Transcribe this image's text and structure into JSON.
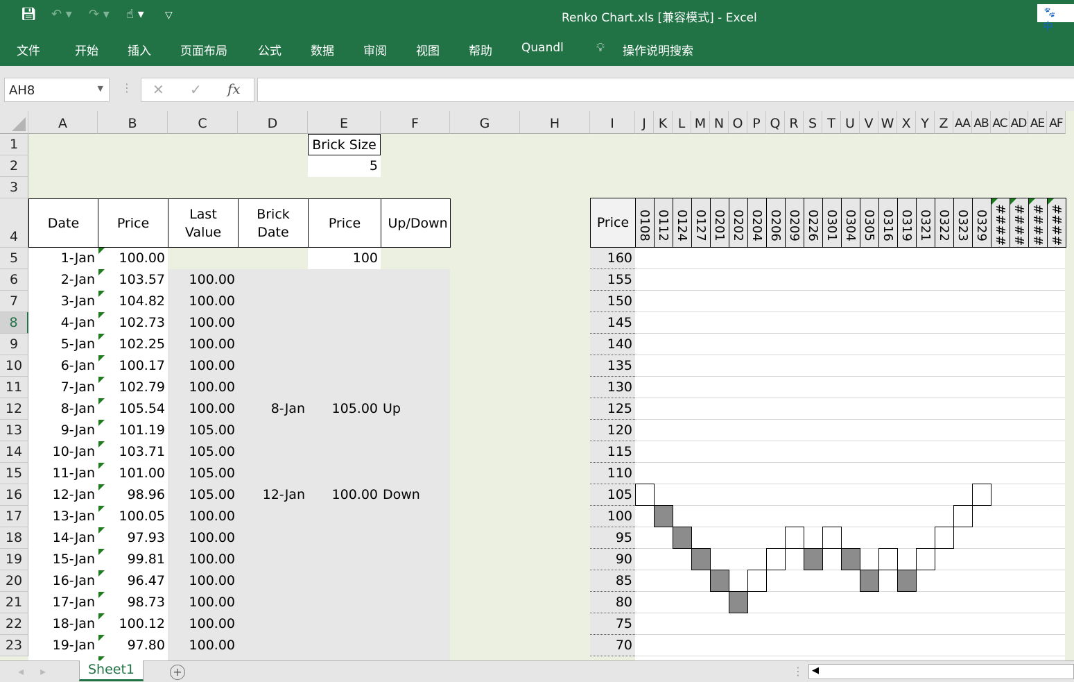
{
  "window": {
    "title": "Renko Chart.xls  [兼容模式]  -  Excel",
    "ime_badge": "中"
  },
  "quick_access": {
    "save": "save-icon",
    "undo": "undo-icon",
    "redo": "redo-icon",
    "touch": "touch-mode-icon",
    "customize": "customize-icon"
  },
  "ribbon": {
    "tabs": [
      "文件",
      "开始",
      "插入",
      "页面布局",
      "公式",
      "数据",
      "审阅",
      "视图",
      "帮助",
      "Quandl"
    ],
    "tell_me": "操作说明搜索"
  },
  "formula_bar": {
    "name_box": "AH8",
    "cancel": "✕",
    "enter": "✓",
    "fx": "fx",
    "value": ""
  },
  "columns": [
    "A",
    "B",
    "C",
    "D",
    "E",
    "F",
    "G",
    "H",
    "I",
    "J",
    "K",
    "L",
    "M",
    "N",
    "O",
    "P",
    "Q",
    "R",
    "S",
    "T",
    "U",
    "V",
    "W",
    "X",
    "Y",
    "Z",
    "AA",
    "AB",
    "AC",
    "AD",
    "AE",
    "AF"
  ],
  "rows": [
    "1",
    "2",
    "3",
    "4",
    "5",
    "6",
    "7",
    "8",
    "9",
    "10",
    "11",
    "12",
    "13",
    "14",
    "15",
    "16",
    "17",
    "18",
    "19",
    "20",
    "21",
    "22",
    "23"
  ],
  "selected_row": "8",
  "brick_size": {
    "label": "Brick Size",
    "value": "5"
  },
  "table": {
    "headers": [
      "Date",
      "Price",
      "Last Value",
      "Brick Date",
      "Price",
      "Up/Down"
    ],
    "first_brick_price": "100",
    "rows": [
      [
        "1-Jan",
        "100.00",
        "",
        "",
        "",
        ""
      ],
      [
        "2-Jan",
        "103.57",
        "100.00",
        "",
        "",
        ""
      ],
      [
        "3-Jan",
        "104.82",
        "100.00",
        "",
        "",
        ""
      ],
      [
        "4-Jan",
        "102.73",
        "100.00",
        "",
        "",
        ""
      ],
      [
        "5-Jan",
        "102.25",
        "100.00",
        "",
        "",
        ""
      ],
      [
        "6-Jan",
        "100.17",
        "100.00",
        "",
        "",
        ""
      ],
      [
        "7-Jan",
        "102.79",
        "100.00",
        "",
        "",
        ""
      ],
      [
        "8-Jan",
        "105.54",
        "100.00",
        "8-Jan",
        "105.00",
        "Up"
      ],
      [
        "9-Jan",
        "101.19",
        "105.00",
        "",
        "",
        ""
      ],
      [
        "10-Jan",
        "103.71",
        "105.00",
        "",
        "",
        ""
      ],
      [
        "11-Jan",
        "101.00",
        "105.00",
        "",
        "",
        ""
      ],
      [
        "12-Jan",
        "98.96",
        "105.00",
        "12-Jan",
        "100.00",
        "Down"
      ],
      [
        "13-Jan",
        "100.05",
        "100.00",
        "",
        "",
        ""
      ],
      [
        "14-Jan",
        "97.93",
        "100.00",
        "",
        "",
        ""
      ],
      [
        "15-Jan",
        "99.81",
        "100.00",
        "",
        "",
        ""
      ],
      [
        "16-Jan",
        "96.47",
        "100.00",
        "",
        "",
        ""
      ],
      [
        "17-Jan",
        "98.73",
        "100.00",
        "",
        "",
        ""
      ],
      [
        "18-Jan",
        "100.12",
        "100.00",
        "",
        "",
        ""
      ],
      [
        "19-Jan",
        "97.80",
        "100.00",
        "",
        "",
        ""
      ]
    ]
  },
  "renko": {
    "price_header": "Price",
    "prices": [
      "160",
      "155",
      "150",
      "145",
      "140",
      "135",
      "130",
      "125",
      "120",
      "115",
      "110",
      "105",
      "100",
      "95",
      "90",
      "85",
      "80",
      "75",
      "70"
    ],
    "date_headers": [
      "0108",
      "0112",
      "0124",
      "0127",
      "0201",
      "0202",
      "0204",
      "0206",
      "0209",
      "0226",
      "0301",
      "0304",
      "0305",
      "0316",
      "0319",
      "0321",
      "0322",
      "0323",
      "0329",
      "#####",
      "#####",
      "#####",
      "#####"
    ],
    "bricks": [
      105,
      100,
      95,
      90,
      85,
      80,
      85,
      90,
      95,
      90,
      95,
      90,
      85,
      90,
      85,
      90,
      95,
      100,
      105
    ],
    "directions": [
      "up",
      "down",
      "down",
      "down",
      "down",
      "down",
      "up",
      "up",
      "up",
      "down",
      "up",
      "down",
      "down",
      "up",
      "down",
      "up",
      "up",
      "up",
      "up"
    ],
    "colors": {
      "up": "#ffffff",
      "down": "#8c8c8c"
    }
  },
  "sheet_tabs": {
    "active": "Sheet1",
    "add": "+"
  }
}
